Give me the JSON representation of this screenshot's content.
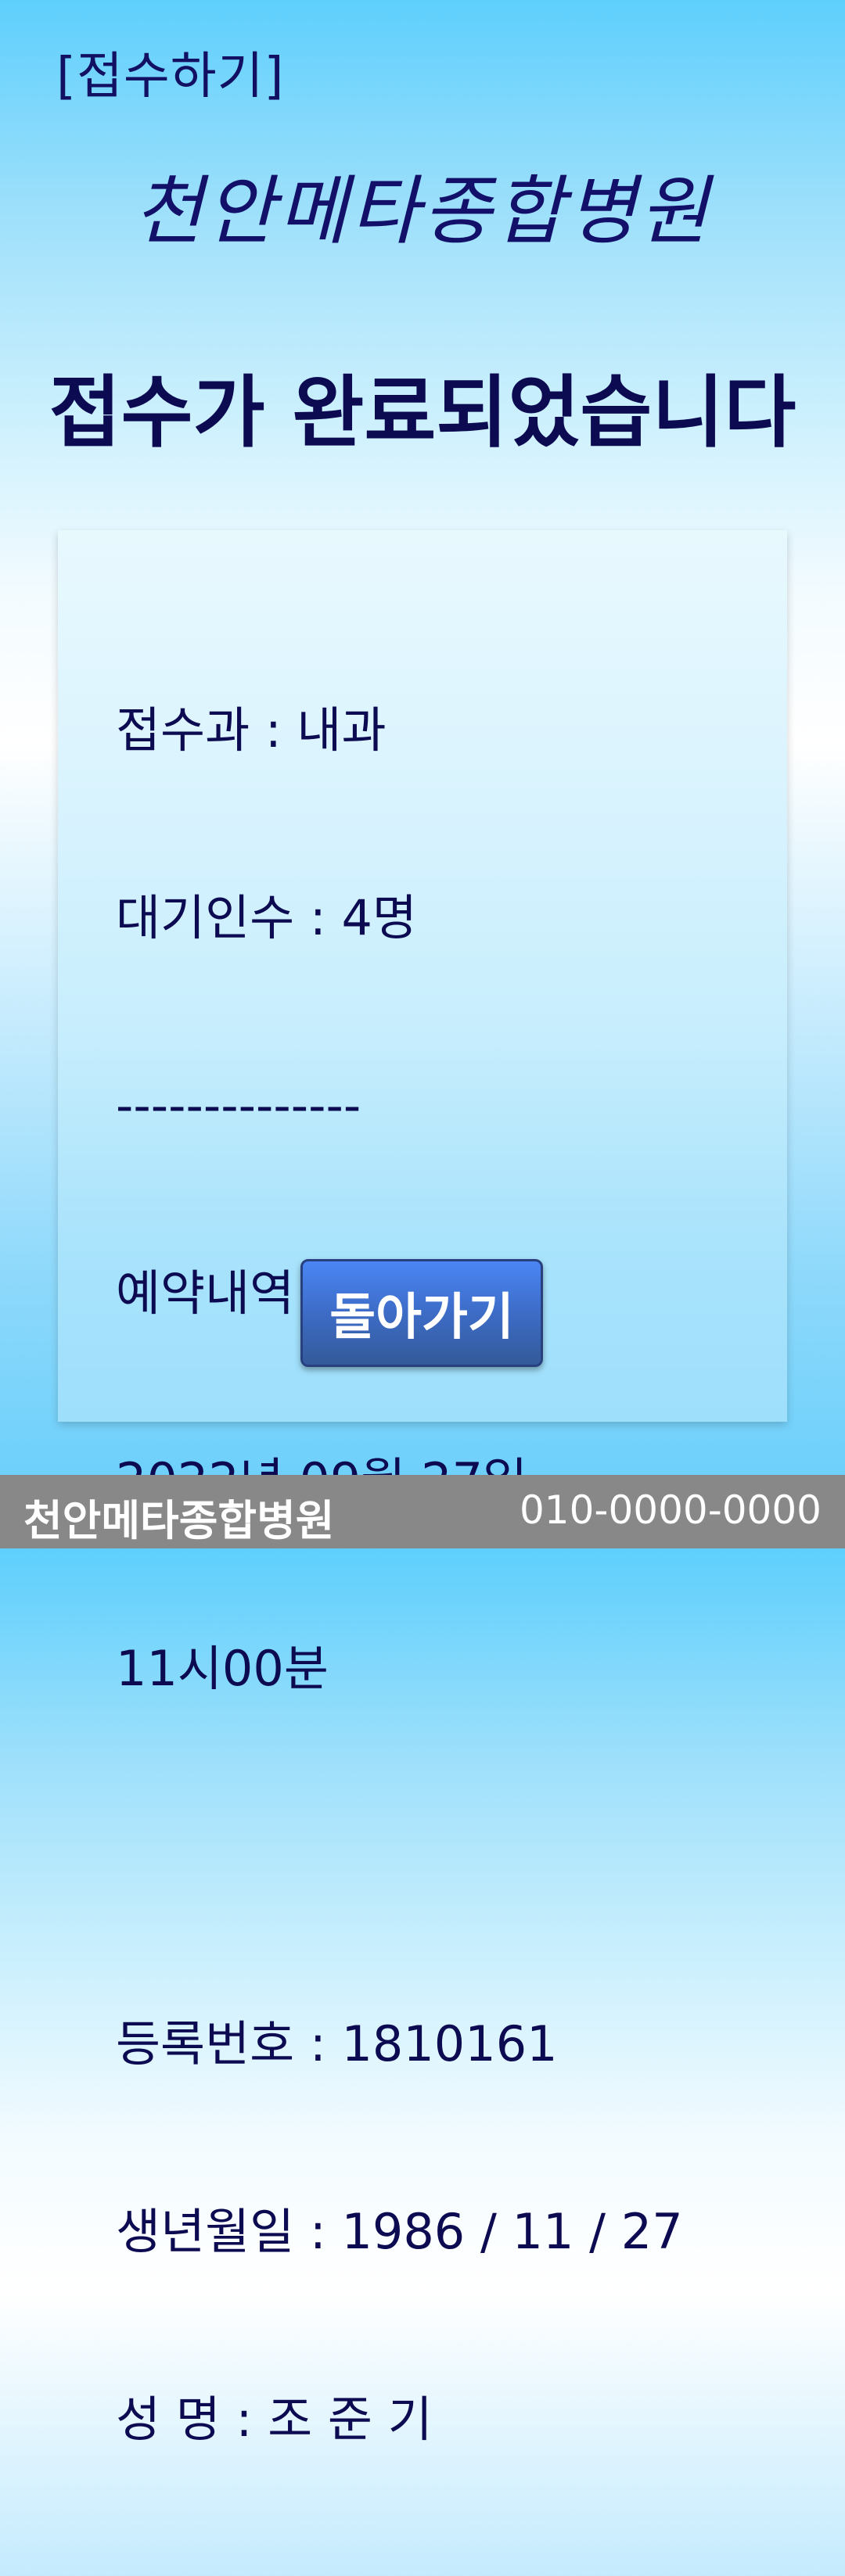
{
  "header": {
    "label": "[접수하기]",
    "hospital_name": "천안메타종합병원"
  },
  "main": {
    "headline": "접수가 완료되었습니다"
  },
  "card": {
    "department": "접수과 : 내과",
    "waiting_count": "대기인수 : 4명",
    "divider": "--------------",
    "reservation_title": "예약내역",
    "reservation_date": "2022년 09월 27일",
    "reservation_time": "11시00분",
    "registration_number": "등록번호 : 1810161",
    "birth_date": "생년월일 : 1986 / 11 / 27",
    "name": "성 명 : 조 준 기",
    "back_button_label": "돌아가기"
  },
  "footer": {
    "hospital_name": "천안메타종합병원",
    "phone": "010-0000-0000"
  }
}
